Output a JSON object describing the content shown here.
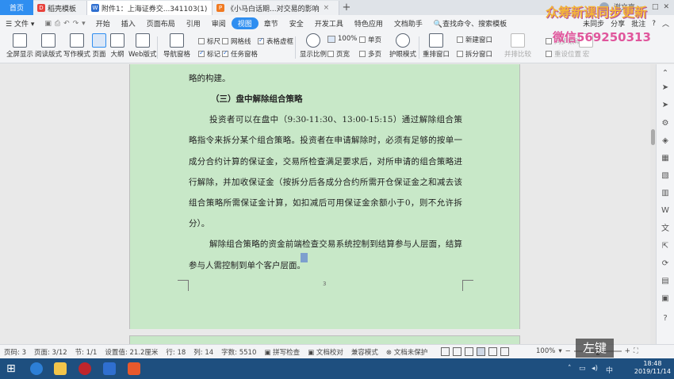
{
  "tabs": {
    "home": "首页",
    "items": [
      {
        "label": "稻壳模板",
        "icon_color": "#e8423c"
      },
      {
        "label": "附件1：上海证券交...341103(1)",
        "icon_color": "#2f6fd0"
      },
      {
        "label": "《小马白话期...对交易的影响",
        "icon_color": "#f07a22"
      }
    ],
    "plus": "+",
    "right_user": "谢文嘉"
  },
  "menu": {
    "file": "文件",
    "items": [
      "开始",
      "插入",
      "页面布局",
      "引用",
      "审阅",
      "视图",
      "章节",
      "安全",
      "开发工具",
      "特色应用",
      "文档助手"
    ],
    "active": "视图",
    "search": "查找命令、搜索模板",
    "sync": "未同步",
    "share": "分享",
    "annotate": "批注"
  },
  "ribbon": {
    "fullscreen": "全屏显示",
    "read_mode": "阅读版式",
    "write_mode": "写作模式",
    "page_view": "页面",
    "outline": "大纲",
    "web_view": "Web版式",
    "nav_pane": "导航窗格",
    "ruler": "标尺",
    "gridlines": "网格线",
    "table_dashed": "表格虚框",
    "marks": "标记",
    "task_pane": "任务窗格",
    "zoom_ratio": "显示比例",
    "zoom_pct": "100%",
    "single_page": "单页",
    "page_width": "页宽",
    "multi_page": "多页",
    "eye_mode": "护眼模式",
    "rearrange": "重排窗口",
    "new_window": "新建窗口",
    "split_window": "拆分窗口",
    "side_by_side": "并排比较",
    "sync_scroll": "同步滚动",
    "reset_position": "重设位置",
    "macro": "宏"
  },
  "document": {
    "line0": "略的构建。",
    "heading": "（三）盘中解除组合策略",
    "para1": "投资者可以在盘中（9:30-11:30、13:00-15:15）通过解除组合策略指令来拆分某个组合策略。投资者在申请解除时，必须有足够的按单一成分合约计算的保证金，交易所检查满足要求后，对所申请的组合策略进行解除，并加收保证金（按拆分后各成分合约所需开仓保证金之和减去该组合策略所需保证金计算，如扣减后可用保证金余额小于0，则不允许拆分）。",
    "para2": "解除组合策略的资金前端检查交易系统控制到结算参与人层面，结算参与人需控制到单个客户层面。",
    "page_number": "3"
  },
  "status": {
    "page_no": "页码: 3",
    "page_of": "页面: 3/12",
    "section": "节: 1/1",
    "setting": "设置值: 21.2厘米",
    "row": "行: 18",
    "col": "列: 14",
    "wordcount": "字数: 5510",
    "spell": "拼写检查",
    "proof": "文档校对",
    "compat": "兼容模式",
    "unprotected": "文档未保护",
    "zoom": "100%"
  },
  "taskbar": {
    "time": "18:48",
    "date": "2019/11/14",
    "lang": "中"
  },
  "overlay": {
    "watermark1": "众筹新课同步更新",
    "watermark2": "微信569250313",
    "key_hint": "左键"
  },
  "colors": {
    "accent": "#2f8ef0",
    "page_bg": "#c8e8c8",
    "taskbar": "#1e4f7f"
  }
}
